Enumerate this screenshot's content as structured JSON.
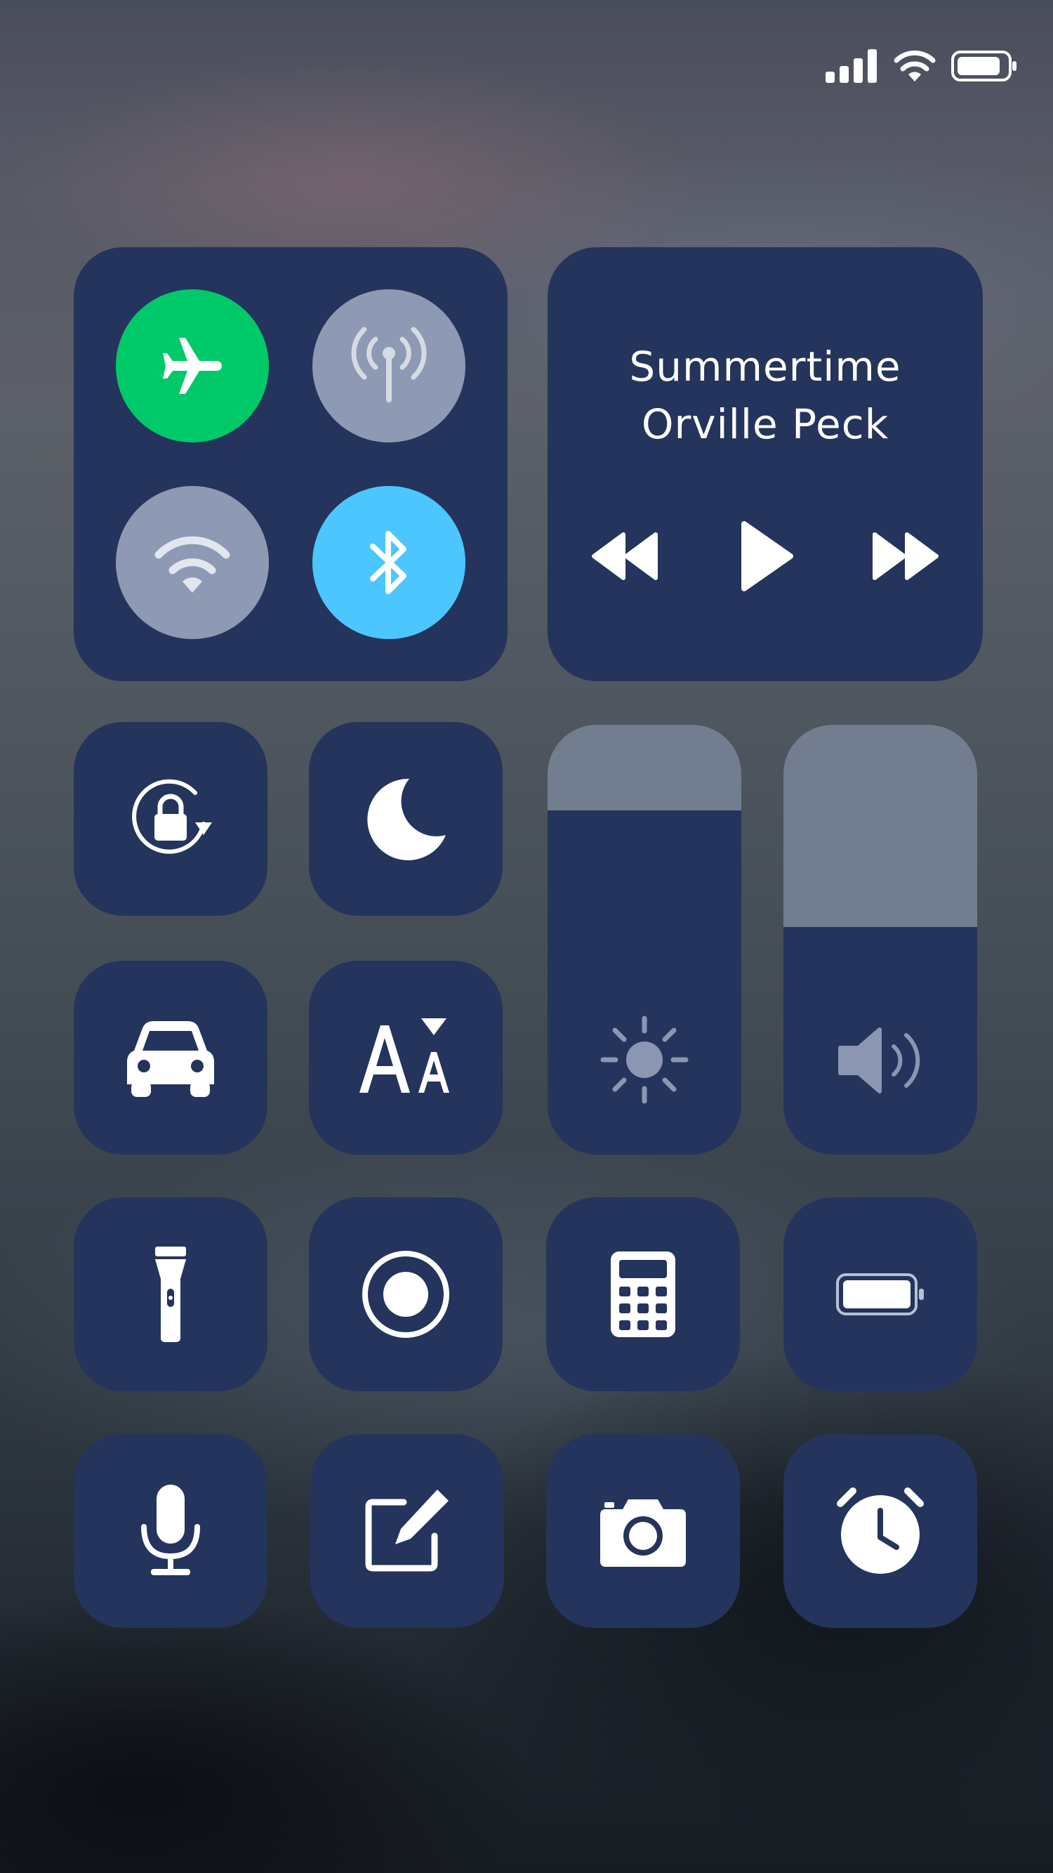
{
  "status_bar": {
    "icons": [
      "cellular-signal-icon",
      "wifi-icon",
      "battery-icon"
    ]
  },
  "connectivity": {
    "airplane": {
      "icon": "airplane-icon",
      "on": true,
      "color": "#00c96a"
    },
    "cellular": {
      "icon": "cellular-antenna-icon",
      "on": false,
      "color": "#8e99b4"
    },
    "wifi": {
      "icon": "wifi-icon",
      "on": false,
      "color": "#8e99b4"
    },
    "bluetooth": {
      "icon": "bluetooth-icon",
      "on": true,
      "color": "#4cc6ff"
    }
  },
  "now_playing": {
    "song": "Summertime",
    "artist": "Orville Peck",
    "controls": [
      "rewind-icon",
      "play-icon",
      "fast-forward-icon"
    ]
  },
  "sliders": {
    "brightness": {
      "icon": "sun-icon",
      "level": 0.8
    },
    "volume": {
      "icon": "speaker-icon",
      "level": 0.53
    }
  },
  "tiles": [
    "rotation-lock-icon",
    "moon-icon",
    "car-icon",
    "text-size-icon",
    "flashlight-icon",
    "screen-record-icon",
    "calculator-icon",
    "battery-icon",
    "microphone-icon",
    "notes-icon",
    "camera-icon",
    "alarm-clock-icon"
  ],
  "colors": {
    "tile": "#24345c",
    "icon": "#ffffff",
    "airplane_on": "#00c96a",
    "bluetooth_on": "#4cc6ff",
    "inactive_circle": "#8e99b4"
  }
}
